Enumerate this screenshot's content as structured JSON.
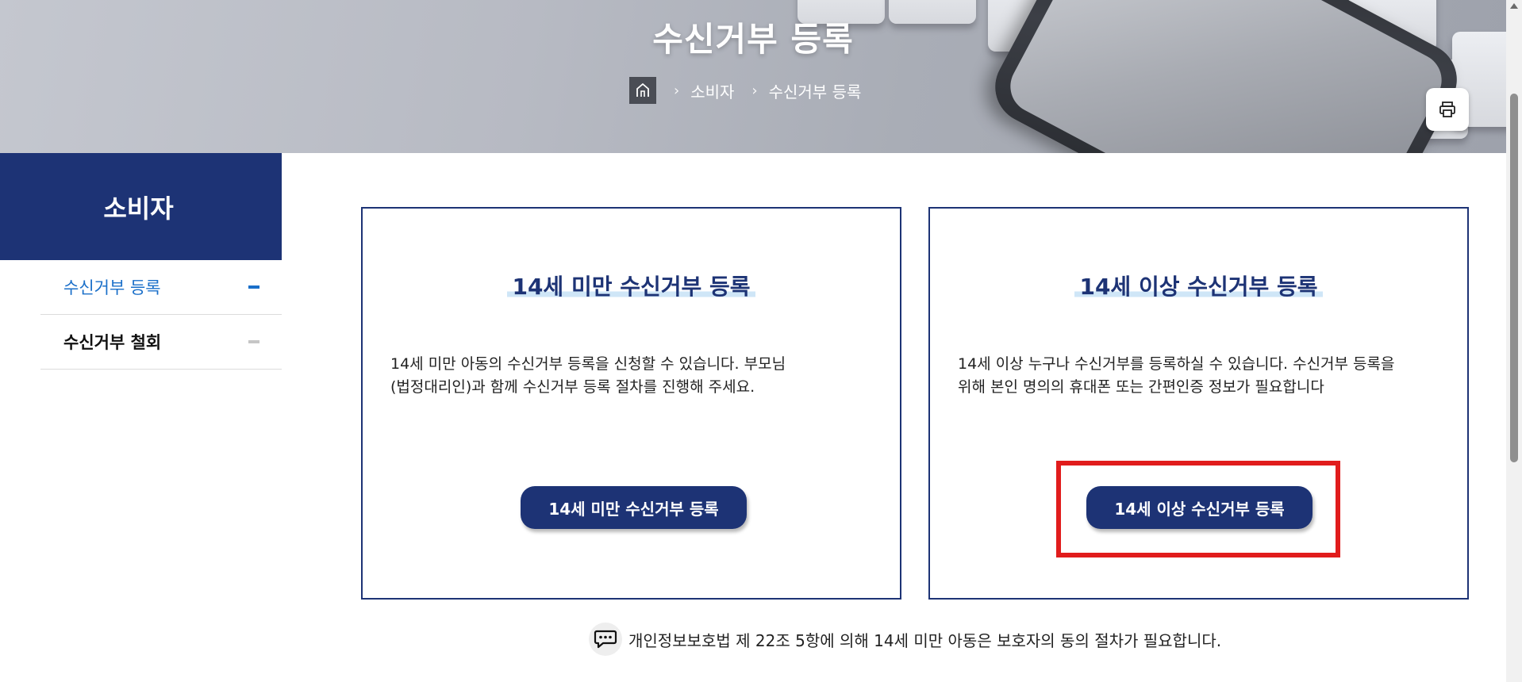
{
  "hero": {
    "title": "수신거부 등록",
    "breadcrumb": [
      "소비자",
      "수신거부 등록"
    ]
  },
  "sidebar": {
    "heading": "소비자",
    "items": [
      {
        "label": "수신거부 등록",
        "active": true
      },
      {
        "label": "수신거부 철회",
        "active": false
      }
    ]
  },
  "cards": [
    {
      "title": "14세 미만 수신거부 등록",
      "desc_line1": "14세 미만 아동의 수신거부 등록을 신청할 수 있습니다. 부모님",
      "desc_line2": "(법정대리인)과 함께 수신거부 등록 절차를 진행해 주세요.",
      "button": "14세 미만 수신거부 등록"
    },
    {
      "title": "14세 이상 수신거부 등록",
      "desc_line1": "14세 이상 누구나 수신거부를 등록하실 수 있습니다. 수신거부 등록을",
      "desc_line2": "위해 본인 명의의 휴대폰 또는 간편인증 정보가 필요합니다",
      "button": "14세 이상 수신거부 등록"
    }
  ],
  "notice": "개인정보보호법 제 22조 5항에 의해 14세 미만 아동은 보호자의 동의 절차가 필요합니다.",
  "colors": {
    "primary": "#1d3375",
    "active_link": "#1a6fc9",
    "highlight": "#e11c1c"
  }
}
